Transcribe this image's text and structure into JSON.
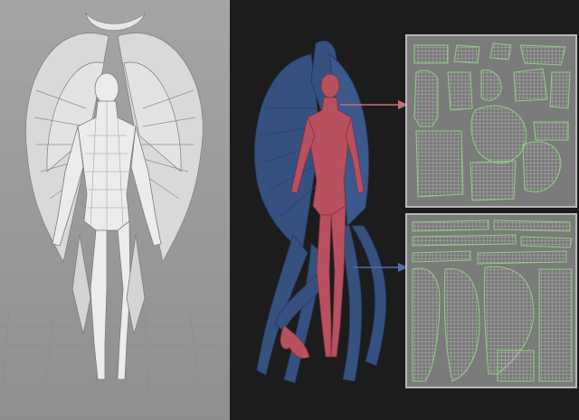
{
  "scene": {
    "left_view": {
      "label": "",
      "kind": "wireframe-viewport"
    },
    "right_view": {
      "label": "",
      "kind": "colored-render"
    },
    "uv_sheets": [
      {
        "id": "body-uv",
        "kind": "uv-layout-top"
      },
      {
        "id": "wings-uv",
        "kind": "uv-layout-bottom"
      }
    ]
  },
  "colors": {
    "viewport_bg": "#9a9a9a",
    "render_bg": "#1c1c1c",
    "body_red": "#b9505f",
    "wings_blue": "#36507f",
    "uv_bg": "#7b7b7b",
    "uv_island_line": "#8dd37e",
    "uv_grid": "#e9e9e9",
    "arrow": "#c57076",
    "arrow_blue": "#4e6fa6"
  },
  "icons": {
    "arrow_top": "arrow-right-icon",
    "arrow_bottom": "arrow-right-icon"
  }
}
